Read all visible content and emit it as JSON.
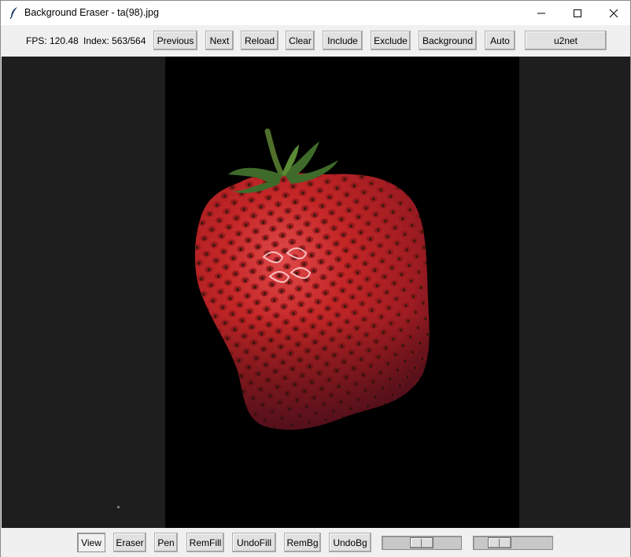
{
  "window": {
    "title": "Background Eraser - ta(98).jpg",
    "icons": {
      "app": "feather-icon",
      "minimize": "minimize-icon",
      "maximize": "maximize-icon",
      "close": "close-icon"
    }
  },
  "toolbar": {
    "fps_label": "FPS: 120.48",
    "index_label": "Index: 563/564",
    "buttons": {
      "previous": "Previous",
      "next": "Next",
      "reload": "Reload",
      "clear": "Clear",
      "include": "Include",
      "exclude": "Exclude",
      "background": "Background",
      "auto": "Auto",
      "model": "u2net"
    }
  },
  "canvas": {
    "image_subject": "strawberry",
    "background_color": "#000000",
    "panel_color": "#1e1e1e"
  },
  "bottombar": {
    "buttons": {
      "view": "View",
      "eraser": "Eraser",
      "pen": "Pen",
      "remfill": "RemFill",
      "undofill": "UndoFill",
      "rembg": "RemBg",
      "undobg": "UndoBg"
    },
    "active_mode": "View",
    "slider1_level": 0.5,
    "slider2_level": 0.25
  }
}
